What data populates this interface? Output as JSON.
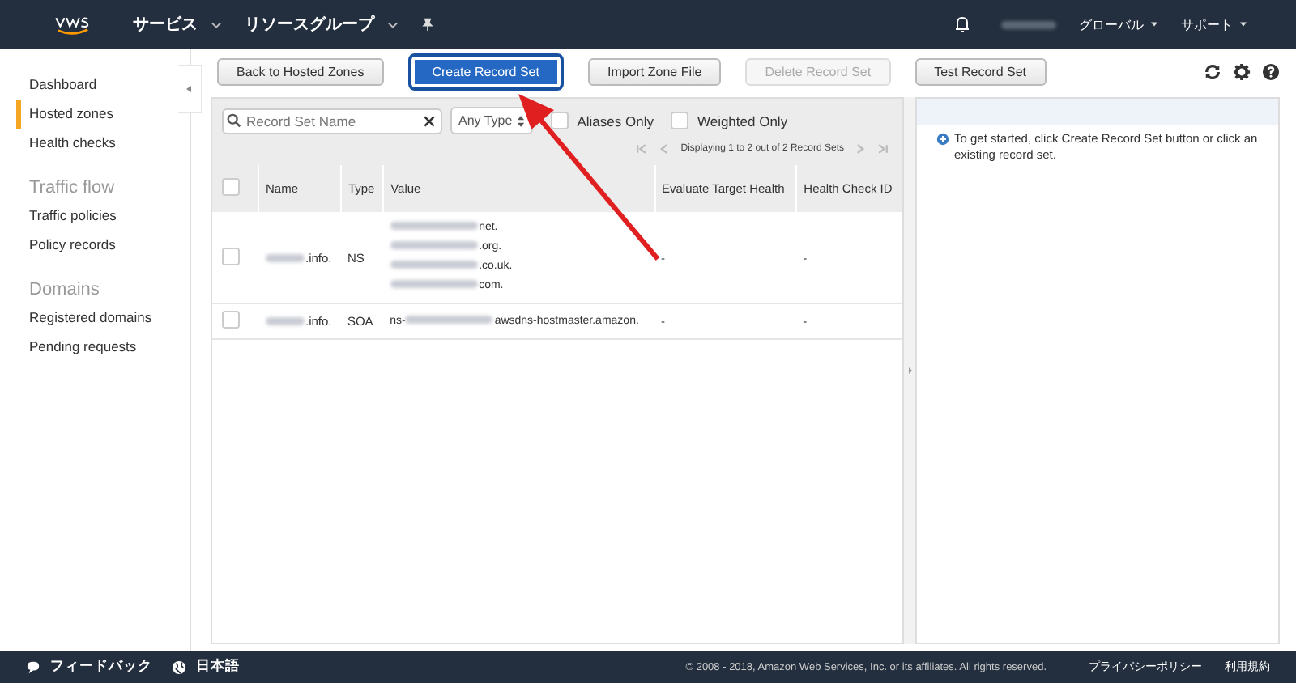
{
  "top_nav": {
    "menus": [
      {
        "label": "サービス"
      },
      {
        "label": "リソースグループ"
      }
    ],
    "right_menus": [
      {
        "label": "グローバル"
      },
      {
        "label": "サポート"
      }
    ]
  },
  "sidebar": {
    "groups": [
      {
        "items": [
          {
            "label": "Dashboard",
            "selected": false
          },
          {
            "label": "Hosted zones",
            "selected": true
          },
          {
            "label": "Health checks",
            "selected": false
          }
        ]
      },
      {
        "heading": "Traffic flow",
        "items": [
          {
            "label": "Traffic policies",
            "selected": false
          },
          {
            "label": "Policy records",
            "selected": false
          }
        ]
      },
      {
        "heading": "Domains",
        "items": [
          {
            "label": "Registered domains",
            "selected": false
          },
          {
            "label": "Pending requests",
            "selected": false
          }
        ]
      }
    ]
  },
  "toolbar": {
    "buttons": [
      {
        "label": "Back to Hosted Zones",
        "kind": "normal",
        "disabled": false,
        "highlighted": false
      },
      {
        "label": "Create Record Set",
        "kind": "primary",
        "disabled": false,
        "highlighted": true
      },
      {
        "label": "Import Zone File",
        "kind": "normal",
        "disabled": false,
        "highlighted": false
      },
      {
        "label": "Delete Record Set",
        "kind": "normal",
        "disabled": true,
        "highlighted": false
      },
      {
        "label": "Test Record Set",
        "kind": "normal",
        "disabled": false,
        "highlighted": false
      }
    ]
  },
  "filter": {
    "placeholder": "Record Set Name",
    "type_select": "Any Type",
    "checkboxes": [
      {
        "label": "Aliases Only",
        "checked": false
      },
      {
        "label": "Weighted Only",
        "checked": false
      }
    ]
  },
  "pagination": "Displaying 1 to 2 out of 2 Record Sets",
  "table": {
    "all_checked": false,
    "columns": [
      "Name",
      "Type",
      "Value",
      "Evaluate Target Health",
      "Health Check ID"
    ],
    "rows": [
      {
        "checked": false,
        "name": ".info.",
        "type": "NS",
        "values": [
          {
            "suffix": "net."
          },
          {
            "suffix": ".org."
          },
          {
            "suffix": ".co.uk."
          },
          {
            "suffix": "com."
          }
        ],
        "evaluate": "-",
        "health_check": "-"
      },
      {
        "checked": false,
        "name": ".info.",
        "type": "SOA",
        "values": [
          {
            "prefix": "ns-",
            "suffix": "awsdns-hostmaster.amazon."
          }
        ],
        "evaluate": "-",
        "health_check": "-"
      }
    ]
  },
  "info_message": "To get started, click Create Record Set button or click an existing record set.",
  "footer": {
    "feedback": "フィードバック",
    "language": "日本語",
    "copyright": "© 2008 - 2018, Amazon Web Services, Inc. or its affiliates. All rights reserved.",
    "links": [
      "プライバシーポリシー",
      "利用規約"
    ]
  }
}
